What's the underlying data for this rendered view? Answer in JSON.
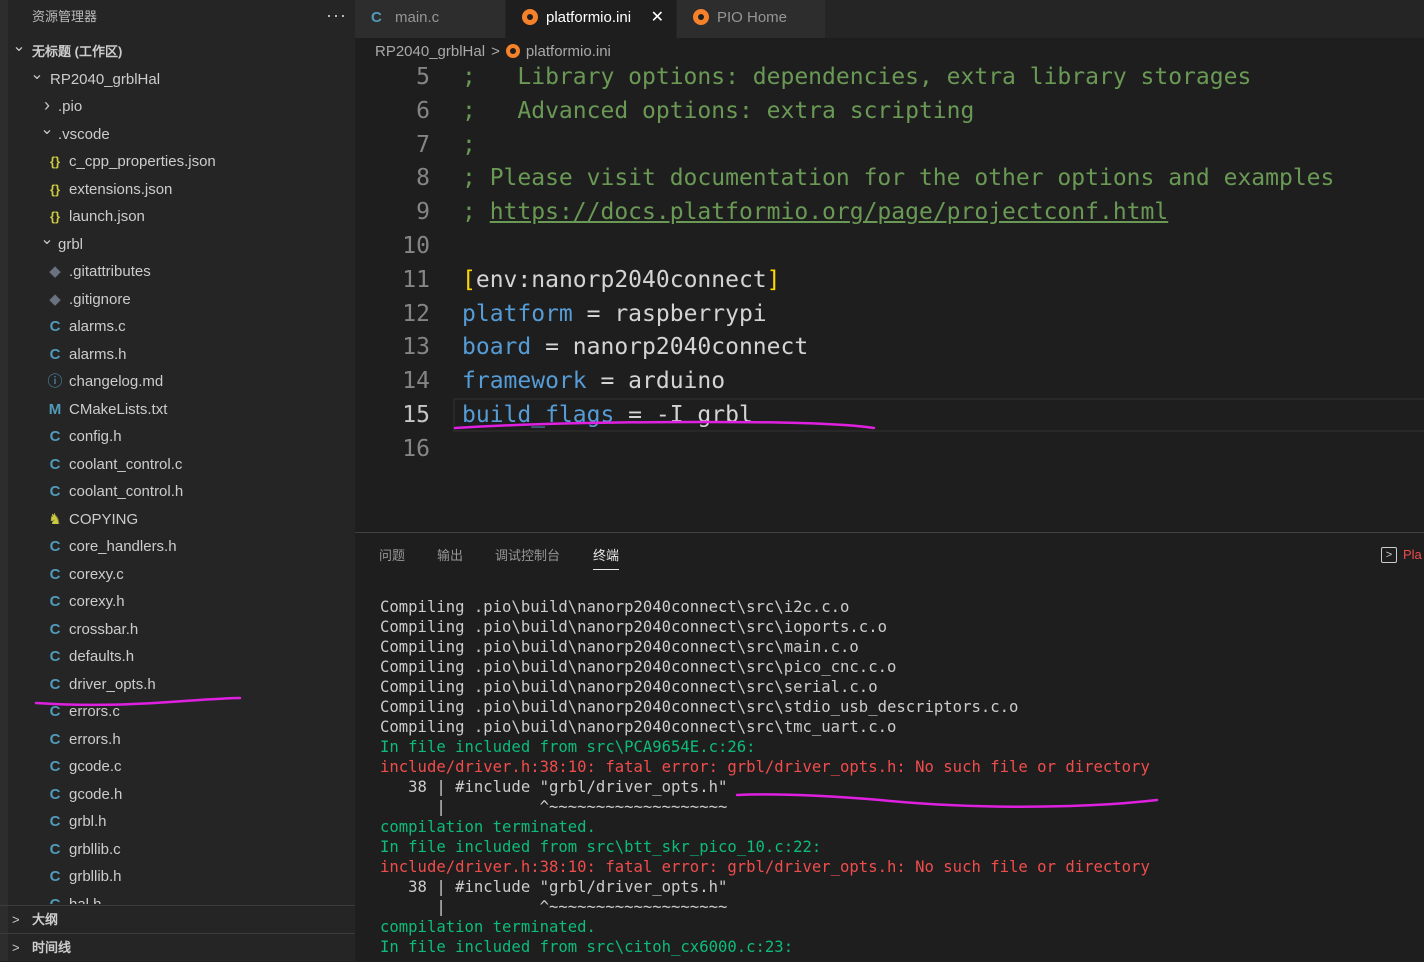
{
  "explorer": {
    "title": "资源管理器",
    "more": "···",
    "tree": [
      {
        "label": "无标题 (工作区)",
        "depth": 0,
        "chev": "v",
        "icon": "",
        "root": true
      },
      {
        "label": "RP2040_grblHal",
        "depth": 1,
        "chev": "v",
        "icon": ""
      },
      {
        "label": ".pio",
        "depth": 2,
        "chev": ">",
        "icon": ""
      },
      {
        "label": ".vscode",
        "depth": 2,
        "chev": "v",
        "icon": ""
      },
      {
        "label": "c_cpp_properties.json",
        "depth": 3,
        "chev": "",
        "icon": "json"
      },
      {
        "label": "extensions.json",
        "depth": 3,
        "chev": "",
        "icon": "json"
      },
      {
        "label": "launch.json",
        "depth": 3,
        "chev": "",
        "icon": "json"
      },
      {
        "label": "grbl",
        "depth": 2,
        "chev": "v",
        "icon": ""
      },
      {
        "label": ".gitattributes",
        "depth": 3,
        "chev": "",
        "icon": "git"
      },
      {
        "label": ".gitignore",
        "depth": 3,
        "chev": "",
        "icon": "git"
      },
      {
        "label": "alarms.c",
        "depth": 3,
        "chev": "",
        "icon": "c"
      },
      {
        "label": "alarms.h",
        "depth": 3,
        "chev": "",
        "icon": "c"
      },
      {
        "label": "changelog.md",
        "depth": 3,
        "chev": "",
        "icon": "md"
      },
      {
        "label": "CMakeLists.txt",
        "depth": 3,
        "chev": "",
        "icon": "m"
      },
      {
        "label": "config.h",
        "depth": 3,
        "chev": "",
        "icon": "c"
      },
      {
        "label": "coolant_control.c",
        "depth": 3,
        "chev": "",
        "icon": "c"
      },
      {
        "label": "coolant_control.h",
        "depth": 3,
        "chev": "",
        "icon": "c"
      },
      {
        "label": "COPYING",
        "depth": 3,
        "chev": "",
        "icon": "key"
      },
      {
        "label": "core_handlers.h",
        "depth": 3,
        "chev": "",
        "icon": "c"
      },
      {
        "label": "corexy.c",
        "depth": 3,
        "chev": "",
        "icon": "c"
      },
      {
        "label": "corexy.h",
        "depth": 3,
        "chev": "",
        "icon": "c"
      },
      {
        "label": "crossbar.h",
        "depth": 3,
        "chev": "",
        "icon": "c"
      },
      {
        "label": "defaults.h",
        "depth": 3,
        "chev": "",
        "icon": "c"
      },
      {
        "label": "driver_opts.h",
        "depth": 3,
        "chev": "",
        "icon": "c"
      },
      {
        "label": "errors.c",
        "depth": 3,
        "chev": "",
        "icon": "c"
      },
      {
        "label": "errors.h",
        "depth": 3,
        "chev": "",
        "icon": "c"
      },
      {
        "label": "gcode.c",
        "depth": 3,
        "chev": "",
        "icon": "c"
      },
      {
        "label": "gcode.h",
        "depth": 3,
        "chev": "",
        "icon": "c"
      },
      {
        "label": "grbl.h",
        "depth": 3,
        "chev": "",
        "icon": "c"
      },
      {
        "label": "grbllib.c",
        "depth": 3,
        "chev": "",
        "icon": "c"
      },
      {
        "label": "grbllib.h",
        "depth": 3,
        "chev": "",
        "icon": "c"
      },
      {
        "label": "hal.h",
        "depth": 3,
        "chev": "",
        "icon": "c"
      }
    ],
    "outline": "大纲",
    "timeline": "时间线",
    "icons": {
      "c": "C",
      "json": "{}",
      "git": "◆",
      "md": "ⓘ",
      "m": "M",
      "key": "♞"
    },
    "icon_names": {
      "c": "c-file-icon",
      "json": "json-file-icon",
      "git": "git-file-icon",
      "md": "markdown-file-icon",
      "m": "cmake-file-icon",
      "key": "license-file-icon"
    }
  },
  "tabs": [
    {
      "label": "main.c",
      "icon": "C",
      "icon_name": "c-file-icon",
      "active": false
    },
    {
      "label": "platformio.ini",
      "icon": "pio",
      "icon_name": "platformio-icon",
      "active": true,
      "close": "✕"
    },
    {
      "label": "PIO Home",
      "icon": "pio",
      "icon_name": "platformio-icon",
      "active": false
    }
  ],
  "breadcrumb": {
    "folder": "RP2040_grblHal",
    "separator": ">",
    "file": "platformio.ini"
  },
  "editor": {
    "lines": [
      {
        "num": "5",
        "tokens": [
          {
            "t": "comment",
            "v": ";   Library options: dependencies, extra library storages"
          }
        ]
      },
      {
        "num": "6",
        "tokens": [
          {
            "t": "comment",
            "v": ";   Advanced options: extra scripting"
          }
        ]
      },
      {
        "num": "7",
        "tokens": [
          {
            "t": "comment",
            "v": ";"
          }
        ]
      },
      {
        "num": "8",
        "tokens": [
          {
            "t": "comment",
            "v": "; Please visit documentation for the other options and examples"
          }
        ]
      },
      {
        "num": "9",
        "tokens": [
          {
            "t": "comment",
            "v": "; "
          },
          {
            "t": "link",
            "v": "https://docs.platformio.org/page/projectconf.html"
          }
        ]
      },
      {
        "num": "10",
        "tokens": []
      },
      {
        "num": "11",
        "tokens": [
          {
            "t": "bracket",
            "v": "["
          },
          {
            "t": "section",
            "v": "env:nanorp2040connect"
          },
          {
            "t": "bracket",
            "v": "]"
          }
        ]
      },
      {
        "num": "12",
        "tokens": [
          {
            "t": "key",
            "v": "platform"
          },
          {
            "t": "op",
            "v": " = "
          },
          {
            "t": "val",
            "v": "raspberrypi"
          }
        ]
      },
      {
        "num": "13",
        "tokens": [
          {
            "t": "key",
            "v": "board"
          },
          {
            "t": "op",
            "v": " = "
          },
          {
            "t": "val",
            "v": "nanorp2040connect"
          }
        ]
      },
      {
        "num": "14",
        "tokens": [
          {
            "t": "key",
            "v": "framework"
          },
          {
            "t": "op",
            "v": " = "
          },
          {
            "t": "val",
            "v": "arduino"
          }
        ]
      },
      {
        "num": "15",
        "tokens": [
          {
            "t": "key",
            "v": "build_flags"
          },
          {
            "t": "op",
            "v": " = "
          },
          {
            "t": "val",
            "v": "-I grbl"
          }
        ],
        "current": true
      },
      {
        "num": "16",
        "tokens": []
      }
    ]
  },
  "panel": {
    "tabs": [
      {
        "label": "问题",
        "active": false
      },
      {
        "label": "输出",
        "active": false
      },
      {
        "label": "调试控制台",
        "active": false
      },
      {
        "label": "终端",
        "active": true
      }
    ],
    "run_label": "Pla",
    "terminal": [
      {
        "c": "normal",
        "v": "Compiling .pio\\build\\nanorp2040connect\\src\\i2c.c.o"
      },
      {
        "c": "normal",
        "v": "Compiling .pio\\build\\nanorp2040connect\\src\\ioports.c.o"
      },
      {
        "c": "normal",
        "v": "Compiling .pio\\build\\nanorp2040connect\\src\\main.c.o"
      },
      {
        "c": "normal",
        "v": "Compiling .pio\\build\\nanorp2040connect\\src\\pico_cnc.c.o"
      },
      {
        "c": "normal",
        "v": "Compiling .pio\\build\\nanorp2040connect\\src\\serial.c.o"
      },
      {
        "c": "normal",
        "v": "Compiling .pio\\build\\nanorp2040connect\\src\\stdio_usb_descriptors.c.o"
      },
      {
        "c": "normal",
        "v": "Compiling .pio\\build\\nanorp2040connect\\src\\tmc_uart.c.o"
      },
      {
        "c": "green",
        "v": "In file included from src\\PCA9654E.c:26:"
      },
      {
        "c": "red",
        "v": "include/driver.h:38:10: fatal error: grbl/driver_opts.h: No such file or directory"
      },
      {
        "c": "normal",
        "v": "   38 | #include \"grbl/driver_opts.h\""
      },
      {
        "c": "normal",
        "v": "      |          ^~~~~~~~~~~~~~~~~~~~"
      },
      {
        "c": "green",
        "v": "compilation terminated."
      },
      {
        "c": "green",
        "v": "In file included from src\\btt_skr_pico_10.c:22:"
      },
      {
        "c": "red",
        "v": "include/driver.h:38:10: fatal error: grbl/driver_opts.h: No such file or directory"
      },
      {
        "c": "normal",
        "v": "   38 | #include \"grbl/driver_opts.h\""
      },
      {
        "c": "normal",
        "v": "      |          ^~~~~~~~~~~~~~~~~~~~"
      },
      {
        "c": "green",
        "v": "compilation terminated."
      },
      {
        "c": "green",
        "v": "In file included from src\\citoh_cx6000.c:23:"
      }
    ]
  },
  "colors": {
    "annotation": "#e020e0",
    "accent_c": "#519aba",
    "pio_orange": "#f5822a"
  }
}
